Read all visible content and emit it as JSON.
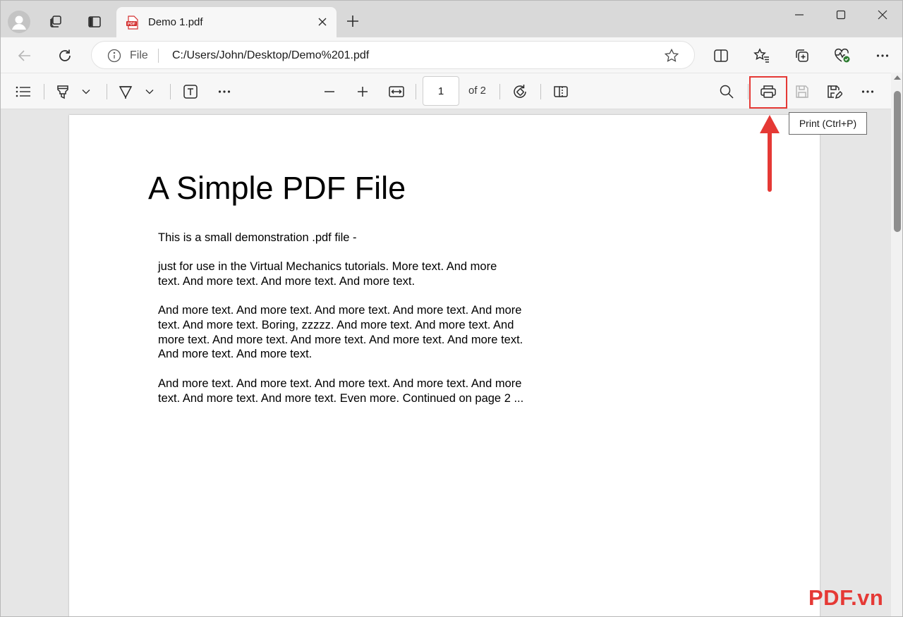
{
  "tab": {
    "title": "Demo 1.pdf",
    "favicon_label": "PDF"
  },
  "address": {
    "scheme_label": "File",
    "url": "C:/Users/John/Desktop/Demo%201.pdf"
  },
  "pdf_toolbar": {
    "current_page": "1",
    "page_count": "of 2",
    "tooltip": "Print (Ctrl+P)"
  },
  "document": {
    "title": "A Simple PDF File",
    "paragraphs": [
      "This is a small demonstration .pdf file -",
      "just for use in the Virtual Mechanics tutorials. More text. And more\ntext. And more text. And more text. And more text.",
      "And more text. And more text. And more text. And more text. And more\ntext. And more text. Boring, zzzzz. And more text. And more text. And\nmore text. And more text. And more text. And more text. And more text.\nAnd more text. And more text.",
      "And more text. And more text. And more text. And more text. And more\ntext. And more text. And more text. Even more. Continued on page 2 ..."
    ]
  },
  "watermark": "PDF.vn",
  "colors": {
    "highlight": "#e53935",
    "favicon": "#d32f2f",
    "health_badge": "#2e7d32"
  },
  "icons": {
    "tabbar": [
      "profile-icon",
      "workspaces-icon",
      "tab-actions-icon",
      "new-tab-icon",
      "minimize-icon",
      "maximize-icon",
      "close-window-icon"
    ],
    "navbar": [
      "back-icon",
      "refresh-icon",
      "info-icon",
      "favorite-star-icon",
      "split-screen-icon",
      "favorites-icon",
      "collections-icon",
      "browser-essentials-icon",
      "more-icon"
    ],
    "pdf_toolbar": [
      "contents-icon",
      "highlight-icon",
      "draw-icon",
      "text-icon",
      "more-tools-icon",
      "zoom-out-icon",
      "zoom-in-icon",
      "fit-width-icon",
      "rotate-icon",
      "page-view-icon",
      "search-icon",
      "print-icon",
      "save-icon",
      "save-as-icon",
      "settings-more-icon"
    ]
  }
}
